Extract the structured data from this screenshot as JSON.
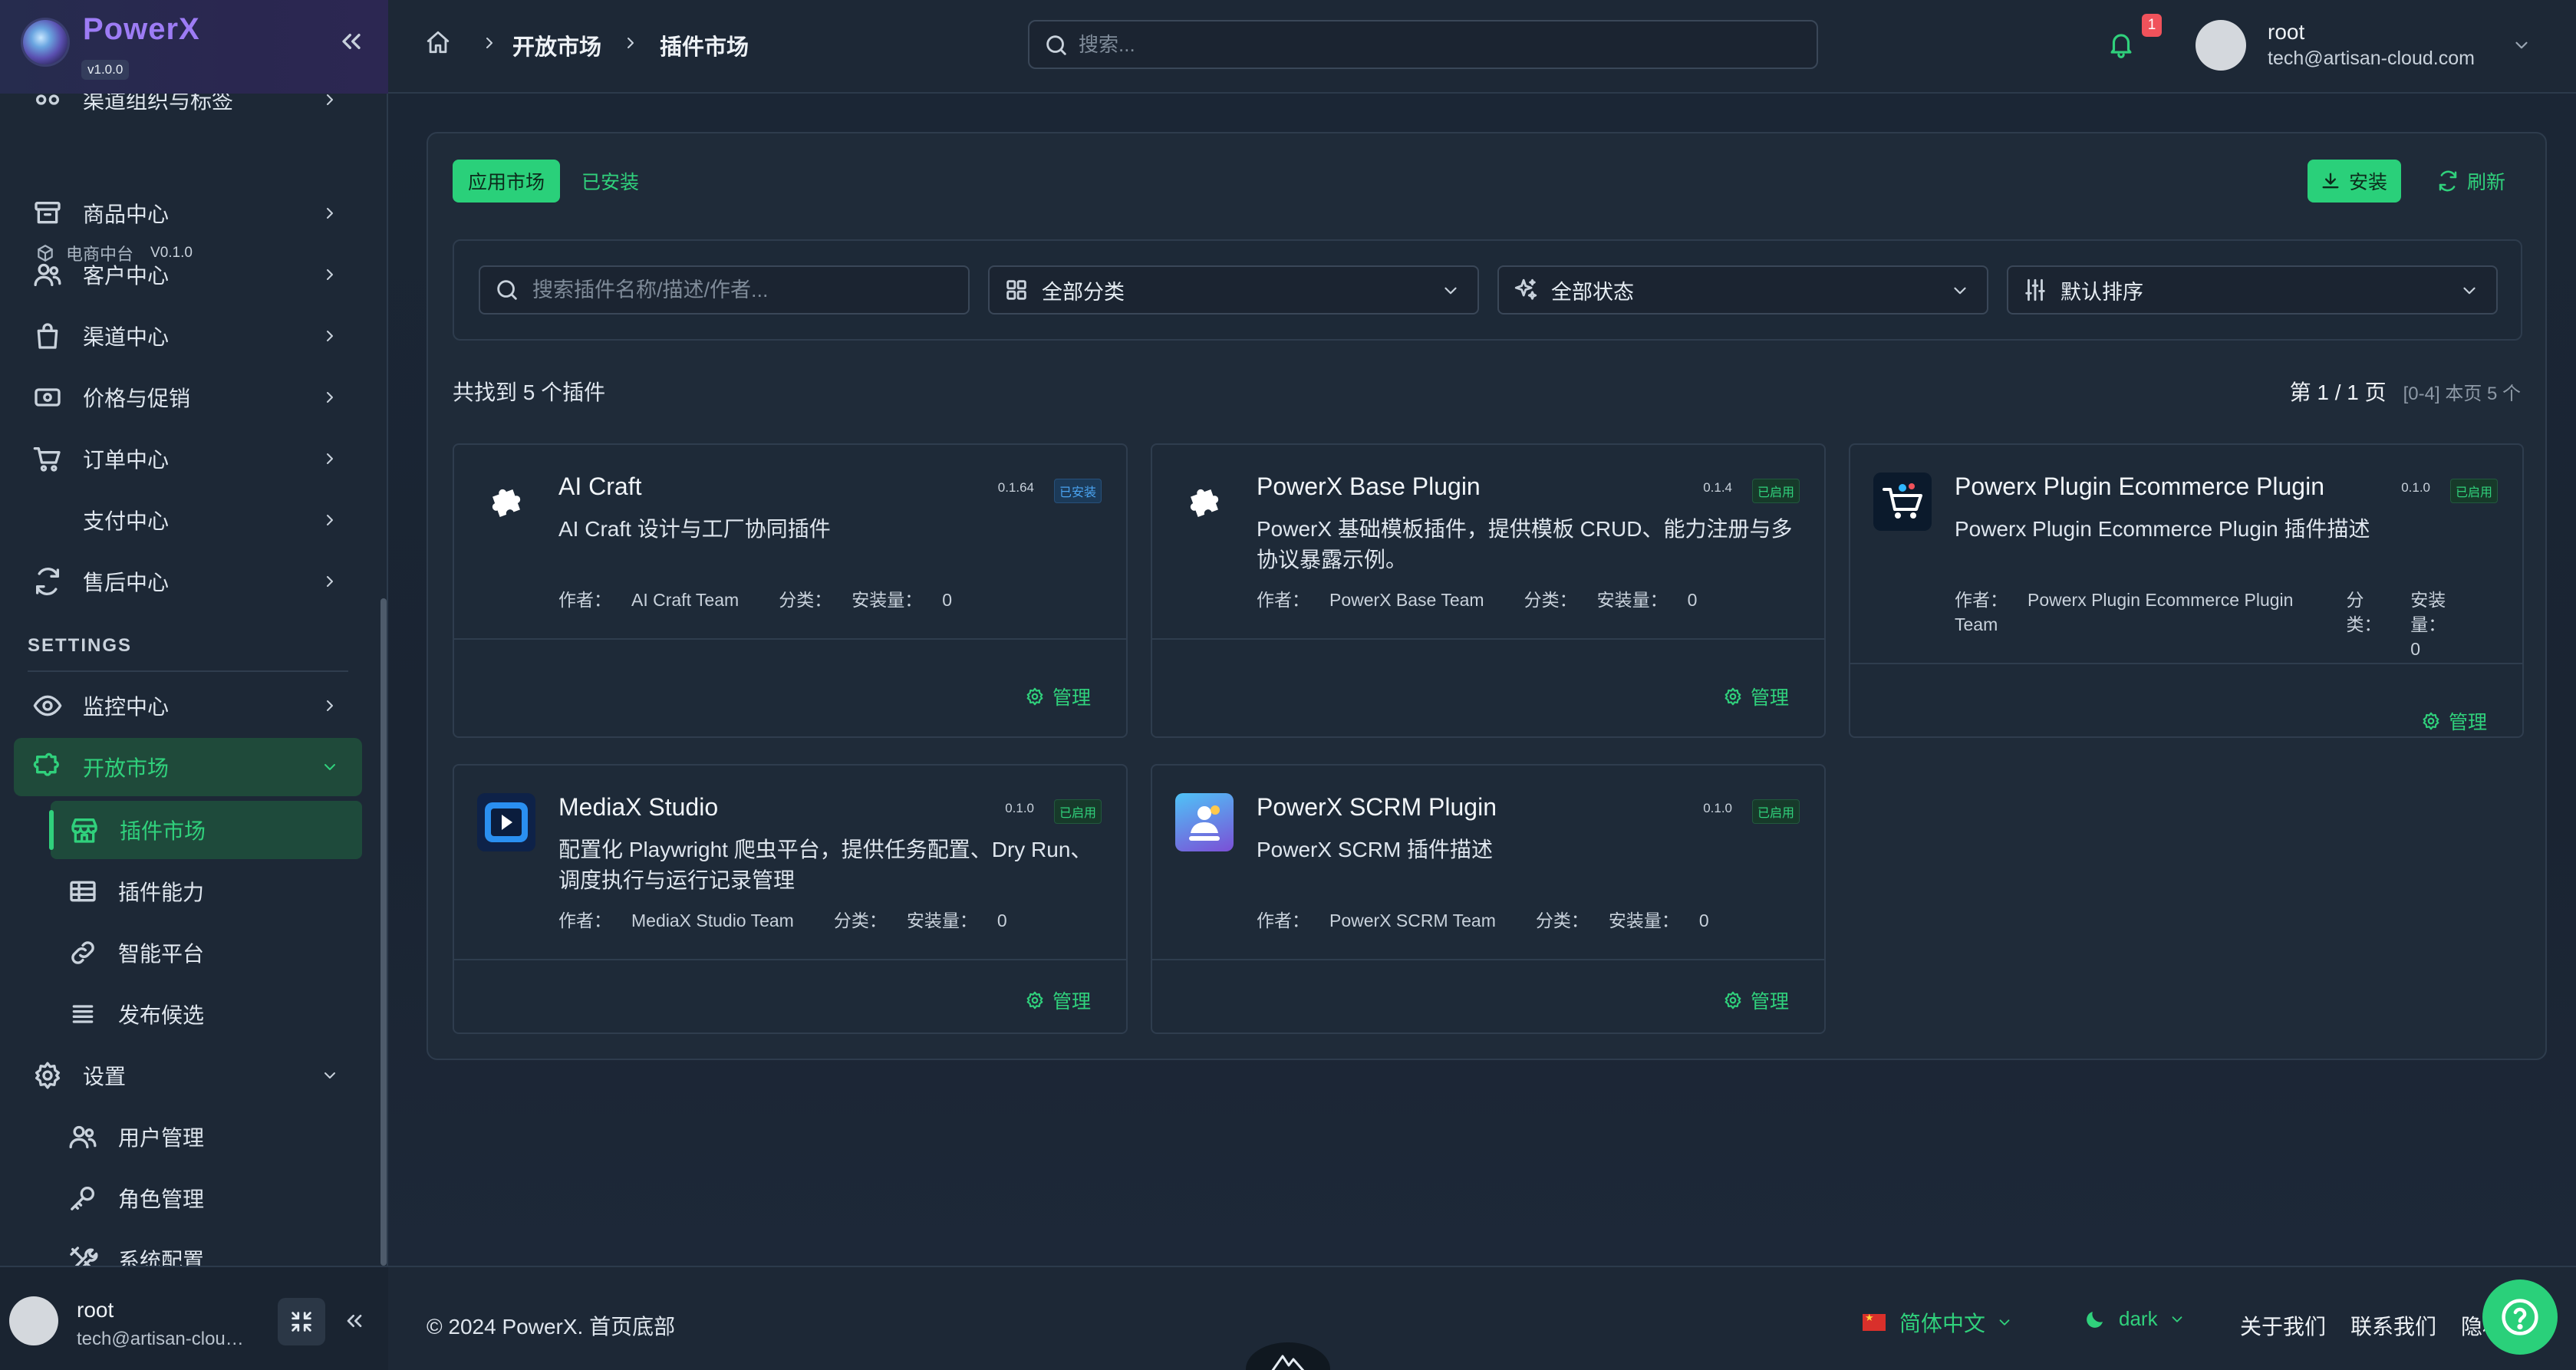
{
  "app": {
    "name": "PowerX",
    "version": "v1.0.0"
  },
  "sidebar": {
    "partial_item": "渠道组织与标签",
    "section_ecommerce": {
      "label": "电商中台",
      "version": "V0.1.0"
    },
    "ecommerce_items": [
      {
        "label": "商品中心",
        "icon": "archive-box-icon"
      },
      {
        "label": "客户中心",
        "icon": "users-icon"
      },
      {
        "label": "渠道中心",
        "icon": "shopping-bag-icon"
      },
      {
        "label": "价格与促销",
        "icon": "banknote-icon"
      },
      {
        "label": "订单中心",
        "icon": "cart-icon"
      },
      {
        "label": "支付中心",
        "icon": ""
      },
      {
        "label": "售后中心",
        "icon": "refresh-icon"
      }
    ],
    "settings_title": "SETTINGS",
    "settings_items": {
      "monitor": "监控中心",
      "open_market": "开放市场",
      "open_market_children": [
        "插件市场",
        "插件能力",
        "智能平台",
        "发布候选"
      ],
      "settings": "设置",
      "settings_children": [
        "用户管理",
        "角色管理",
        "系统配置"
      ]
    },
    "user": {
      "name": "root",
      "email": "tech@artisan-cloud.com"
    }
  },
  "topbar": {
    "breadcrumb": [
      "开放市场",
      "插件市场"
    ],
    "search_placeholder": "搜索...",
    "notification_count": "1",
    "user": {
      "name": "root",
      "email": "tech@artisan-cloud.com"
    }
  },
  "market": {
    "tabs": {
      "market": "应用市场",
      "installed": "已安装"
    },
    "buttons": {
      "install": "安装",
      "refresh": "刷新"
    },
    "filters": {
      "search_placeholder": "搜索插件名称/描述/作者...",
      "category": "全部分类",
      "status": "全部状态",
      "sort": "默认排序"
    },
    "result_count": "共找到 5 个插件",
    "page_number": "第 1 / 1 页",
    "page_range": "[0-4] 本页 5 个",
    "author_prefix": "作者：",
    "category_prefix": "分类：",
    "installs_prefix": "安装量：",
    "manage_label": "管理",
    "plugins": [
      {
        "name": "AI Craft",
        "version": "0.1.64",
        "status": "已安装",
        "description": "AI Craft 设计与工厂协同插件",
        "author": "AI Craft Team",
        "installs": "0"
      },
      {
        "name": "PowerX Base Plugin",
        "version": "0.1.4",
        "status": "已启用",
        "description": "PowerX 基础模板插件，提供模板 CRUD、能力注册与多协议暴露示例。",
        "author": "PowerX Base Team",
        "installs": "0"
      },
      {
        "name": "Powerx Plugin Ecommerce Plugin",
        "version": "0.1.0",
        "status": "已启用",
        "description": "Powerx Plugin Ecommerce Plugin 插件描述",
        "author": "Powerx Plugin Ecommerce Plugin Team",
        "installs": "0"
      },
      {
        "name": "MediaX Studio",
        "version": "0.1.0",
        "status": "已启用",
        "description": "配置化 Playwright 爬虫平台，提供任务配置、Dry Run、调度执行与运行记录管理",
        "author": "MediaX Studio Team",
        "installs": "0"
      },
      {
        "name": "PowerX SCRM Plugin",
        "version": "0.1.0",
        "status": "已启用",
        "description": "PowerX SCRM 插件描述",
        "author": "PowerX SCRM Team",
        "installs": "0"
      }
    ]
  },
  "footer": {
    "copyright": "© 2024 PowerX. 首页底部",
    "language": "简体中文",
    "theme": "dark",
    "links": [
      "关于我们",
      "联系我们",
      "隐私"
    ]
  },
  "colors": {
    "accent": "#2ad07a",
    "sidebar_bg": "#1d2836",
    "brand": "#9d7cf5",
    "badge_installed": "#4aa3f0"
  }
}
